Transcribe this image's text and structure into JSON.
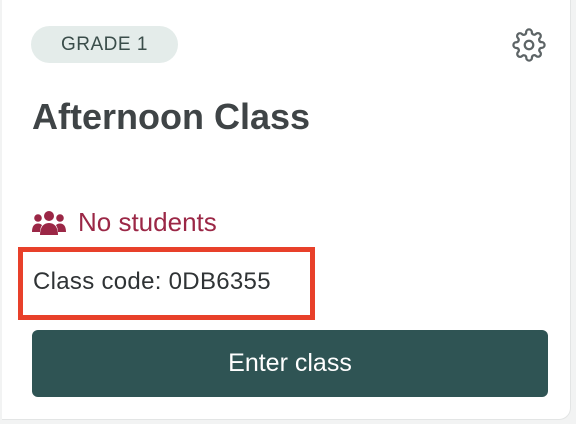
{
  "card": {
    "grade_badge": "GRADE 1",
    "title": "Afternoon Class",
    "students_status": "No students",
    "class_code": "Class code: 0DB6355",
    "enter_button": "Enter class",
    "settings_icon": "gear-icon",
    "students_icon": "users-group-icon"
  },
  "colors": {
    "button_bg": "#2f5454",
    "badge_bg": "#e4ecea",
    "students_text": "#9b2746",
    "highlight_border": "#e8402a"
  }
}
